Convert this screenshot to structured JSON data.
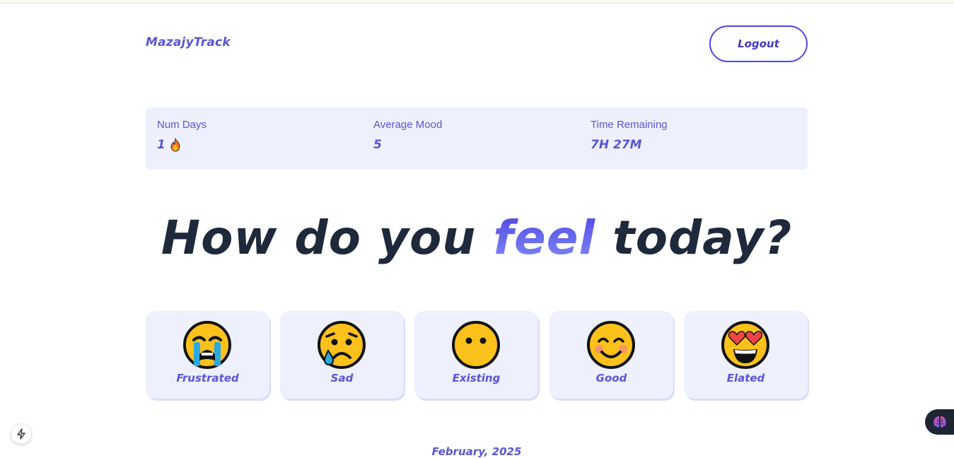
{
  "header": {
    "brand": "MazajyTrack",
    "logout_label": "Logout"
  },
  "stats": [
    {
      "label": "Num Days",
      "value": "1",
      "icon": "fire-icon"
    },
    {
      "label": "Average Mood",
      "value": "5"
    },
    {
      "label": "Time Remaining",
      "value": "7H 27M"
    }
  ],
  "headline": {
    "before": "How do you ",
    "accent": "feel",
    "after": " today?"
  },
  "moods": [
    {
      "label": "Frustrated",
      "icon": "loudly-crying-face-icon"
    },
    {
      "label": "Sad",
      "icon": "crying-face-icon"
    },
    {
      "label": "Existing",
      "icon": "face-without-mouth-icon"
    },
    {
      "label": "Good",
      "icon": "smiling-face-icon"
    },
    {
      "label": "Elated",
      "icon": "heart-eyes-face-icon"
    }
  ],
  "calendar": {
    "month": "February, 2025"
  },
  "colors": {
    "accent": "#5b55d6",
    "heading": "#1e293b",
    "panel": "#eef1fd"
  }
}
